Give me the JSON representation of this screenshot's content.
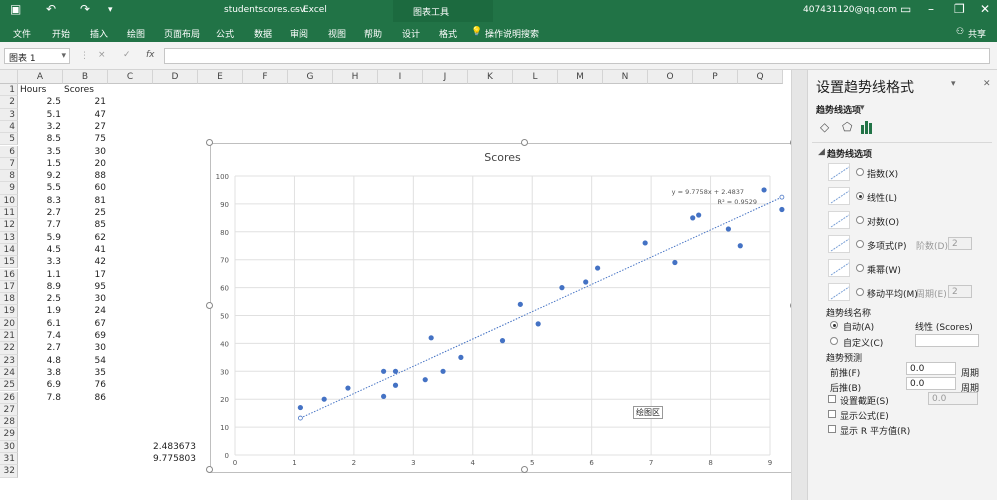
{
  "window": {
    "filename": "studentscores.csv",
    "app": "Excel",
    "context_group": "图表工具",
    "account": "407431120@qq.com",
    "share_label": "共享"
  },
  "ribbon": {
    "tabs": [
      "文件",
      "开始",
      "插入",
      "绘图",
      "页面布局",
      "公式",
      "数据",
      "审阅",
      "视图",
      "帮助",
      "设计",
      "格式"
    ],
    "search_label": "操作说明搜索"
  },
  "formula_bar": {
    "name_box": "图表 1",
    "cancel": "×",
    "enter": "✓",
    "fx": "fx",
    "content": ""
  },
  "grid": {
    "columns": [
      "A",
      "B",
      "C",
      "D",
      "E",
      "F",
      "G",
      "H",
      "I",
      "J",
      "K",
      "L",
      "M",
      "N",
      "O",
      "P",
      "Q"
    ],
    "rows": [
      "1",
      "2",
      "3",
      "4",
      "5",
      "6",
      "7",
      "8",
      "9",
      "10",
      "11",
      "12",
      "13",
      "14",
      "15",
      "16",
      "17",
      "18",
      "19",
      "20",
      "21",
      "22",
      "23",
      "24",
      "25",
      "26",
      "27",
      "28",
      "29",
      "30",
      "31",
      "32"
    ],
    "header_row": [
      "Hours",
      "Scores"
    ],
    "data": [
      [
        "2.5",
        "21"
      ],
      [
        "5.1",
        "47"
      ],
      [
        "3.2",
        "27"
      ],
      [
        "8.5",
        "75"
      ],
      [
        "3.5",
        "30"
      ],
      [
        "1.5",
        "20"
      ],
      [
        "9.2",
        "88"
      ],
      [
        "5.5",
        "60"
      ],
      [
        "8.3",
        "81"
      ],
      [
        "2.7",
        "25"
      ],
      [
        "7.7",
        "85"
      ],
      [
        "5.9",
        "62"
      ],
      [
        "4.5",
        "41"
      ],
      [
        "3.3",
        "42"
      ],
      [
        "1.1",
        "17"
      ],
      [
        "8.9",
        "95"
      ],
      [
        "2.5",
        "30"
      ],
      [
        "1.9",
        "24"
      ],
      [
        "6.1",
        "67"
      ],
      [
        "7.4",
        "69"
      ],
      [
        "2.7",
        "30"
      ],
      [
        "4.8",
        "54"
      ],
      [
        "3.8",
        "35"
      ],
      [
        "6.9",
        "76"
      ],
      [
        "7.8",
        "86"
      ]
    ],
    "intercept_value": "2.483673",
    "slope_value": "9.775803"
  },
  "chart": {
    "plot_area_tooltip": "绘图区",
    "trend_equation": "y = 9.7758x + 2.4837",
    "trend_r2": "R² = 0.9529",
    "trend_color": "#4472c4",
    "point_color": "#4472c4"
  },
  "chart_data": {
    "type": "scatter",
    "title": "Scores",
    "xlim": [
      0,
      9
    ],
    "ylim": [
      0,
      100
    ],
    "x_ticks": [
      "0",
      "1",
      "2",
      "3",
      "4",
      "5",
      "6",
      "7",
      "8",
      "9"
    ],
    "y_ticks": [
      "0",
      "10",
      "20",
      "30",
      "40",
      "50",
      "60",
      "70",
      "80",
      "90",
      "100"
    ],
    "grid": true,
    "series": [
      {
        "x": [
          2.5,
          5.1,
          3.2,
          8.5,
          3.5,
          1.5,
          9.2,
          5.5,
          8.3,
          2.7,
          7.7,
          5.9,
          4.5,
          3.3,
          1.1,
          8.9,
          2.5,
          1.9,
          6.1,
          7.4,
          2.7,
          4.8,
          3.8,
          6.9,
          7.8
        ],
        "y": [
          21,
          47,
          27,
          75,
          30,
          20,
          88,
          60,
          81,
          25,
          85,
          62,
          41,
          42,
          17,
          95,
          30,
          24,
          67,
          69,
          30,
          54,
          35,
          76,
          86
        ]
      }
    ],
    "trendline": {
      "type": "linear",
      "slope": 9.7758,
      "intercept": 2.4837,
      "x_range": [
        1.1,
        9.2
      ]
    }
  },
  "panel": {
    "title": "设置趋势线格式",
    "dropdown": "趋势线选项",
    "section": "趋势线选项",
    "types": [
      {
        "label": "指数(X)",
        "selected": false
      },
      {
        "label": "线性(L)",
        "selected": true
      },
      {
        "label": "对数(O)",
        "selected": false
      },
      {
        "label": "多项式(P)",
        "selected": false,
        "param_label": "阶数(D)",
        "param_value": "2"
      },
      {
        "label": "乘幂(W)",
        "selected": false
      },
      {
        "label": "移动平均(M)",
        "selected": false,
        "param_label": "周期(E)",
        "param_value": "2"
      }
    ],
    "name_label": "趋势线名称",
    "auto_label": "自动(A)",
    "auto_value": "线性 (Scores)",
    "custom_label": "自定义(C)",
    "forecast_label": "趋势预测",
    "forward_label": "前推(F)",
    "forward_value": "0.0",
    "forward_unit": "周期",
    "backward_label": "后推(B)",
    "backward_value": "0.0",
    "backward_unit": "周期",
    "intercept_label": "设置截距(S)",
    "intercept_value": "0.0",
    "show_eq_label": "显示公式(E)",
    "show_r2_label": "显示 R 平方值(R)"
  }
}
